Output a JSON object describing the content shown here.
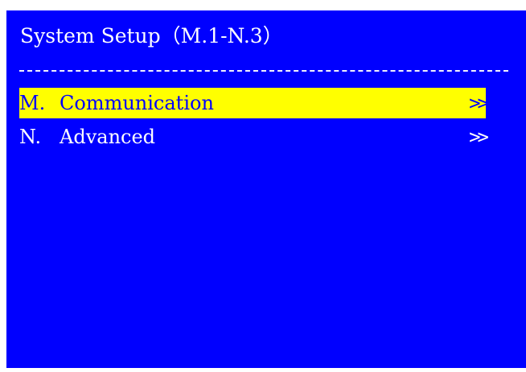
{
  "colors": {
    "background": "#0000ff",
    "text": "#ffffff",
    "highlight_bg": "#ffff00",
    "highlight_text": "#0000ff"
  },
  "header": {
    "title": "System Setup（M.1-N.3）",
    "divider": "------------------------------------------------"
  },
  "menu": {
    "items": [
      {
        "key": "M.",
        "label": "Communication",
        "arrow": ">>",
        "selected": true
      },
      {
        "key": "N.",
        "label": "Advanced",
        "arrow": ">>",
        "selected": false
      }
    ]
  }
}
